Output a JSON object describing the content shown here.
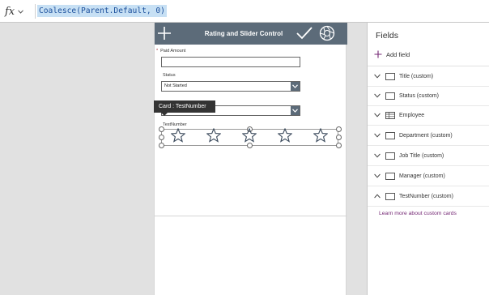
{
  "formula_bar": {
    "fx_label": "fx",
    "formula": "Coalesce(Parent.Default, 0)"
  },
  "app": {
    "header_title": "Rating and Slider Control",
    "fields": {
      "paid_amount_label": "Paid Amount",
      "paid_amount_required_mark": "*",
      "status_label": "Status",
      "status_value": "Not Started",
      "testnumber_label": "TestNumber"
    },
    "tooltip": "Card : TestNumber",
    "rating_stars": 5
  },
  "fields_pane": {
    "title": "Fields",
    "add_field_label": "Add field",
    "items": [
      {
        "label": "Title (custom)",
        "icon": "text-field-icon",
        "expanded": false
      },
      {
        "label": "Status (custom)",
        "icon": "text-field-icon",
        "expanded": false
      },
      {
        "label": "Employee",
        "icon": "table-field-icon",
        "expanded": false
      },
      {
        "label": "Department (custom)",
        "icon": "text-field-icon",
        "expanded": false
      },
      {
        "label": "Job Title (custom)",
        "icon": "text-field-icon",
        "expanded": false
      },
      {
        "label": "Manager (custom)",
        "icon": "text-field-icon",
        "expanded": false
      },
      {
        "label": "TestNumber (custom)",
        "icon": "text-field-icon",
        "expanded": true
      }
    ],
    "learn_more_link": "Learn more about custom cards"
  },
  "colors": {
    "header_bg": "#5c6b79",
    "formula_highlight": "#c7e0f4",
    "link": "#742774",
    "accent_plus": "#742774"
  }
}
